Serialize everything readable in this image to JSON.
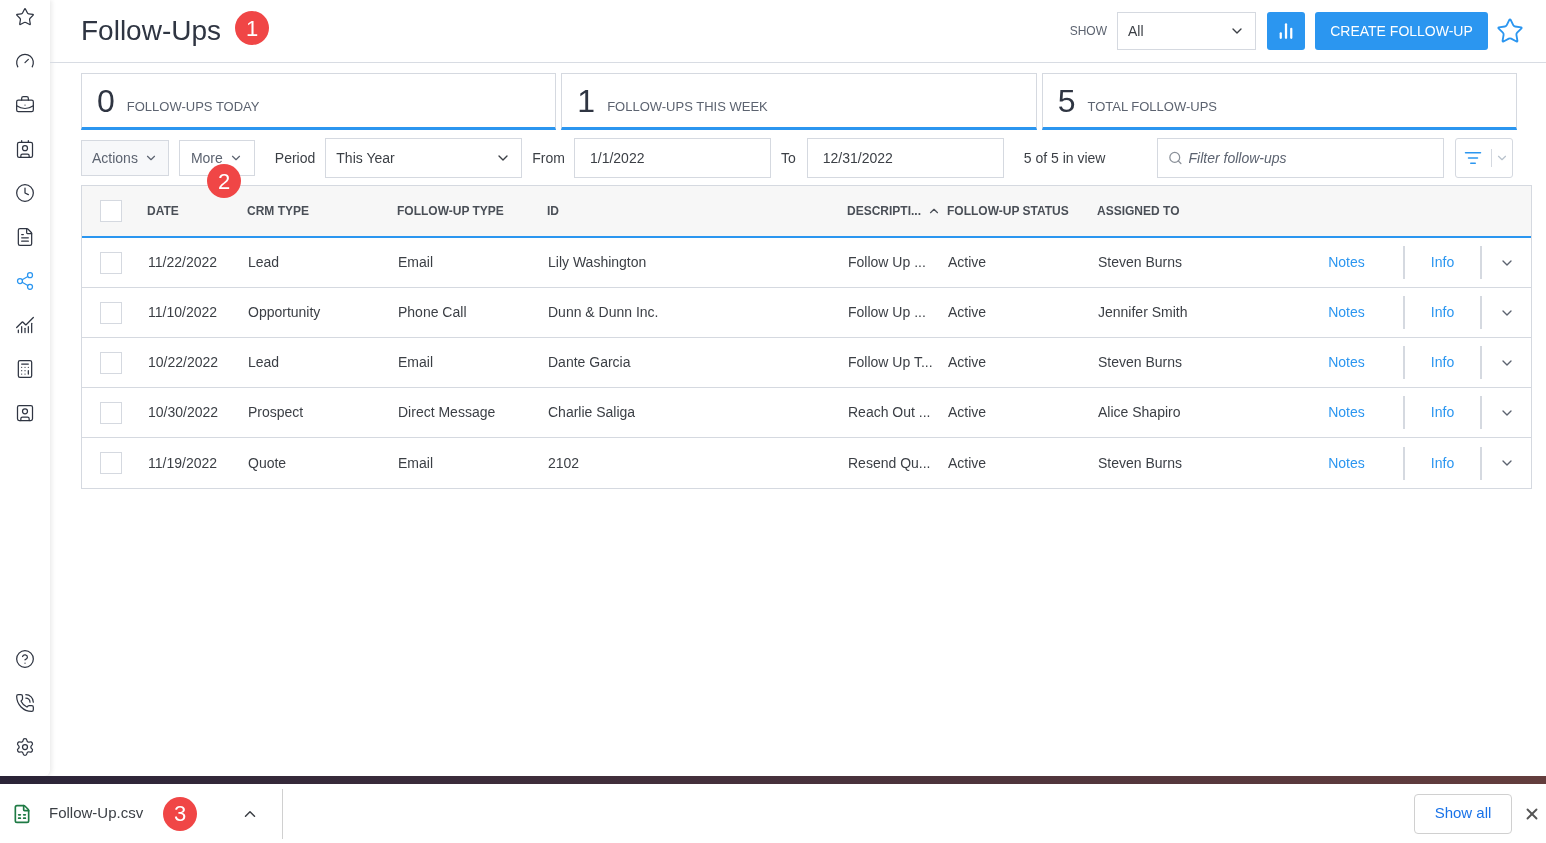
{
  "sidebar": {
    "top_items": [
      {
        "kind": "star",
        "selected": false
      },
      {
        "kind": "gauge",
        "selected": false
      },
      {
        "kind": "briefcase",
        "selected": false
      },
      {
        "kind": "contact",
        "selected": false
      },
      {
        "kind": "clock",
        "selected": false
      },
      {
        "kind": "invoice",
        "selected": false
      },
      {
        "kind": "share",
        "selected": true
      },
      {
        "kind": "chart",
        "selected": false
      },
      {
        "kind": "calculator",
        "selected": false
      },
      {
        "kind": "badge",
        "selected": false
      }
    ],
    "bottom_items": [
      {
        "kind": "help",
        "selected": false
      },
      {
        "kind": "phone",
        "selected": false
      },
      {
        "kind": "settings",
        "selected": false
      }
    ]
  },
  "header": {
    "title": "Follow-Ups",
    "marker": "1",
    "show_label": "SHOW",
    "show_value": "All",
    "create_button": "CREATE FOLLOW-UP"
  },
  "stats": [
    {
      "value": "0",
      "label": "FOLLOW-UPS TODAY"
    },
    {
      "value": "1",
      "label": "FOLLOW-UPS THIS WEEK"
    },
    {
      "value": "5",
      "label": "TOTAL FOLLOW-UPS"
    }
  ],
  "toolbar": {
    "actions": "Actions",
    "more": "More",
    "marker": "2",
    "period_label": "Period",
    "period_value": "This Year",
    "from_label": "From",
    "from_value": "1/1/2022",
    "to_label": "To",
    "to_value": "12/31/2022",
    "count": "5 of 5 in view",
    "filter_placeholder": "Filter follow-ups"
  },
  "table": {
    "all_checked": false,
    "columns": [
      {
        "label": "DATE",
        "sorted": false
      },
      {
        "label": "CRM TYPE",
        "sorted": false
      },
      {
        "label": "FOLLOW-UP TYPE",
        "sorted": false
      },
      {
        "label": "ID",
        "sorted": false
      },
      {
        "label": "DESCRIPTI...",
        "sorted": true
      },
      {
        "label": "FOLLOW-UP STATUS",
        "sorted": false
      },
      {
        "label": "ASSIGNED TO",
        "sorted": false
      }
    ],
    "rows": [
      {
        "checked": false,
        "cells": [
          "11/22/2022",
          "Lead",
          "Email",
          "Lily Washington",
          "Follow Up ...",
          "Active",
          "Steven Burns"
        ],
        "notes": "Notes",
        "info": "Info"
      },
      {
        "checked": false,
        "cells": [
          "11/10/2022",
          "Opportunity",
          "Phone Call",
          "Dunn & Dunn Inc.",
          "Follow Up ...",
          "Active",
          "Jennifer Smith"
        ],
        "notes": "Notes",
        "info": "Info"
      },
      {
        "checked": false,
        "cells": [
          "10/22/2022",
          "Lead",
          "Email",
          "Dante Garcia",
          "Follow Up T...",
          "Active",
          "Steven Burns"
        ],
        "notes": "Notes",
        "info": "Info"
      },
      {
        "checked": false,
        "cells": [
          "10/30/2022",
          "Prospect",
          "Direct Message",
          "Charlie Saliga",
          "Reach Out ...",
          "Active",
          "Alice Shapiro"
        ],
        "notes": "Notes",
        "info": "Info"
      },
      {
        "checked": false,
        "cells": [
          "11/19/2022",
          "Quote",
          "Email",
          "2102",
          "Resend Qu...",
          "Active",
          "Steven Burns"
        ],
        "notes": "Notes",
        "info": "Info"
      }
    ]
  },
  "download_bar": {
    "file_name": "Follow-Up.csv",
    "marker": "3",
    "show_all": "Show all"
  }
}
